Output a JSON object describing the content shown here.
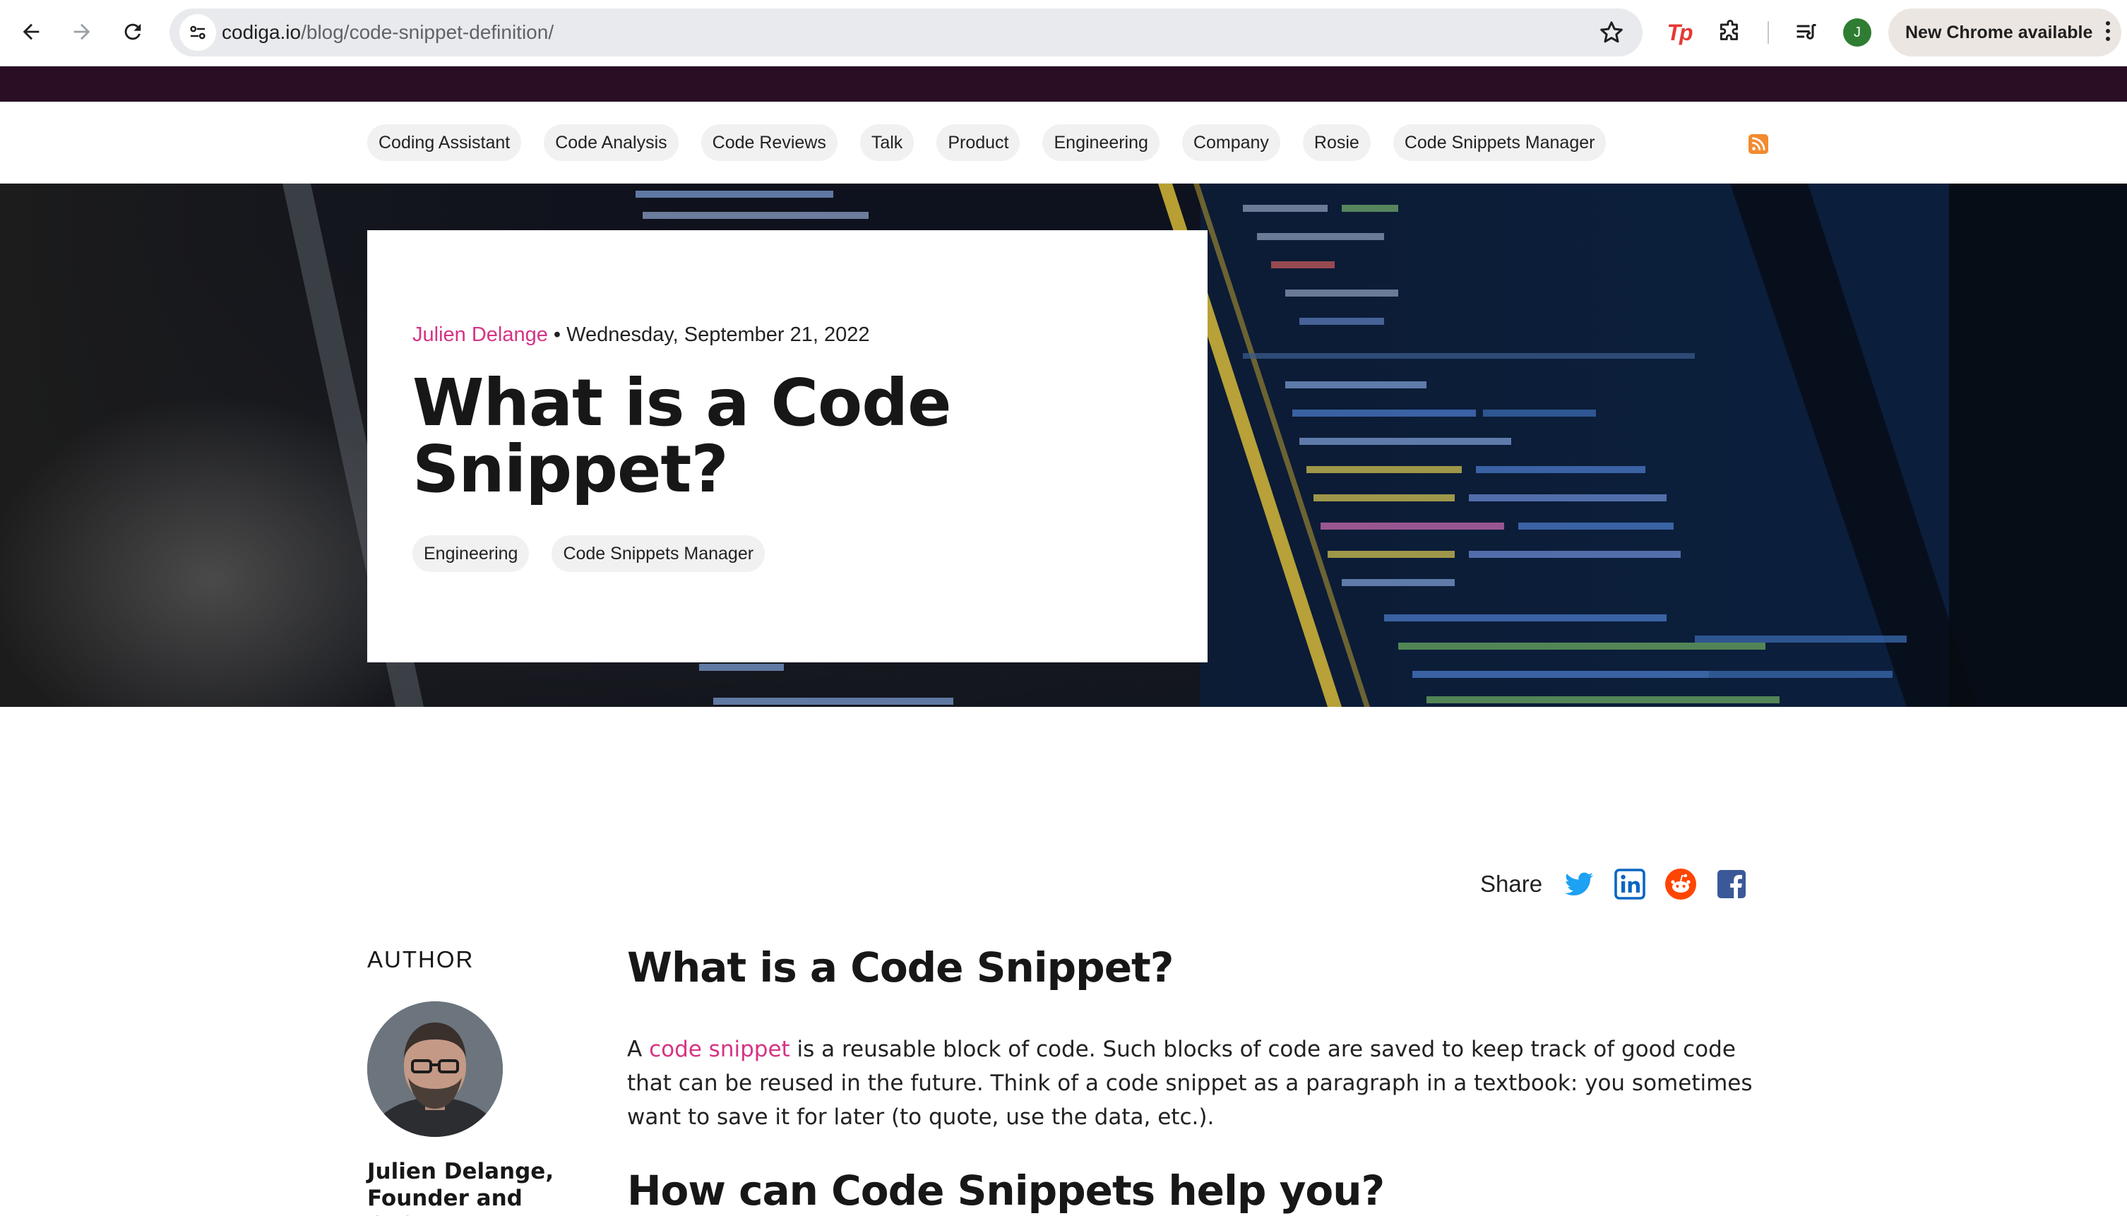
{
  "browser": {
    "url_host": "codiga.io",
    "url_path": "/blog/code-snippet-definition/",
    "profile_initial": "J",
    "update_label": "New Chrome available",
    "extension_label": "Tp",
    "icons": [
      "back-arrow-icon",
      "forward-arrow-icon",
      "reload-icon",
      "site-info-icon",
      "bookmark-star-icon",
      "extensions-puzzle-icon",
      "reading-list-icon",
      "more-vert-icon"
    ]
  },
  "nav": {
    "categories": [
      "Coding Assistant",
      "Code Analysis",
      "Code Reviews",
      "Talk",
      "Product",
      "Engineering",
      "Company",
      "Rosie",
      "Code Snippets Manager"
    ],
    "rss_icon": "rss-icon"
  },
  "hero": {
    "author": "Julien Delange",
    "separator": "•",
    "date": "Wednesday, September 21, 2022",
    "title": "What is a Code Snippet?",
    "tags": [
      "Engineering",
      "Code Snippets Manager"
    ]
  },
  "share": {
    "label": "Share",
    "networks": [
      {
        "name": "twitter-icon",
        "color": "#1da1f2"
      },
      {
        "name": "linkedin-icon",
        "color": "#0a66c2"
      },
      {
        "name": "reddit-icon",
        "color": "#ff4500"
      },
      {
        "name": "facebook-icon",
        "color": "#1877f2"
      }
    ]
  },
  "author_box": {
    "heading": "AUTHOR",
    "name": "Julien Delange, Founder and CEO"
  },
  "article": {
    "heading1": "What is a Code Snippet?",
    "para1_prefix": "A ",
    "para1_link": "code snippet",
    "para1_rest": " is a reusable block of code. Such blocks of code are saved to keep track of good code that can be reused in the future. Think of a code snippet as a paragraph in a textbook: you sometimes want to save it for later (to quote, use the data, etc.).",
    "heading2": "How can Code Snippets help you?"
  },
  "colors": {
    "accent": "#d63384",
    "topbar": "#2a0f24",
    "chip_bg": "#f1f1f1"
  }
}
